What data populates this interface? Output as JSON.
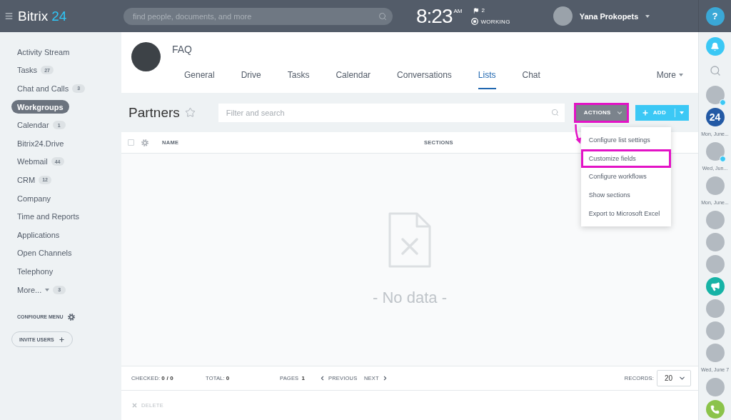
{
  "top_bar": {
    "logo": {
      "text": "Bitrix",
      "number": "24"
    },
    "search": {
      "placeholder": "find people, documents, and more"
    },
    "clock": {
      "time": "8:23",
      "period": "AM"
    },
    "flags": "2",
    "work_status": "WORKING",
    "user": {
      "name": "Yana Prokopets"
    },
    "help": "?"
  },
  "sidebar": {
    "items": [
      {
        "label": "Activity Stream",
        "selected": false,
        "dropdown": false
      },
      {
        "label": "Tasks",
        "count": "27",
        "selected": false,
        "dropdown": false
      },
      {
        "label": "Chat and Calls",
        "count": "3",
        "selected": false,
        "dropdown": false
      },
      {
        "label": "Workgroups",
        "selected": true,
        "dropdown": false
      },
      {
        "label": "Calendar",
        "count": "1",
        "selected": false,
        "dropdown": false
      },
      {
        "label": "Bitrix24.Drive",
        "selected": false,
        "dropdown": false
      },
      {
        "label": "Webmail",
        "count": "44",
        "selected": false,
        "dropdown": false
      },
      {
        "label": "CRM",
        "count": "12",
        "selected": false,
        "dropdown": false
      },
      {
        "label": "Company",
        "selected": false,
        "dropdown": false
      },
      {
        "label": "Time and Reports",
        "selected": false,
        "dropdown": false
      },
      {
        "label": "Applications",
        "selected": false,
        "dropdown": false
      },
      {
        "label": "Open Channels",
        "selected": false,
        "dropdown": false
      },
      {
        "label": "Telephony",
        "selected": false,
        "dropdown": false
      },
      {
        "label": "More...",
        "count": "3",
        "selected": false,
        "dropdown": true
      }
    ],
    "configure": "CONFIGURE MENU",
    "invite": "INVITE USERS"
  },
  "group": {
    "title": "FAQ",
    "tabs": [
      {
        "label": "General",
        "selected": false
      },
      {
        "label": "Drive",
        "selected": false
      },
      {
        "label": "Tasks",
        "selected": false
      },
      {
        "label": "Calendar",
        "selected": false
      },
      {
        "label": "Conversations",
        "selected": false
      },
      {
        "label": "Lists",
        "selected": true
      },
      {
        "label": "Chat",
        "selected": false
      }
    ],
    "more": "More"
  },
  "list": {
    "title": "Partners",
    "filter": {
      "placeholder": "Filter and search"
    },
    "actions": {
      "label": "ACTIONS",
      "highlighted": true
    },
    "add": {
      "label": "ADD"
    },
    "menu": {
      "pointer_arrow": true,
      "items": [
        {
          "label": "Configure list settings",
          "highlighted": false
        },
        {
          "label": "Customize fields",
          "highlighted": true
        },
        {
          "label": "Configure workflows",
          "highlighted": false
        },
        {
          "label": "Show sections",
          "highlighted": false
        },
        {
          "label": "Export to Microsoft Excel",
          "highlighted": false
        }
      ]
    }
  },
  "table": {
    "select_all": {
      "checked": false
    },
    "columns": [
      "NAME",
      "SECTIONS"
    ],
    "empty_text": "- No data -"
  },
  "footer": {
    "checked_label": "CHECKED:",
    "checked": "0 / 0",
    "total_label": "TOTAL:",
    "total": "0",
    "pages_label": "PAGES",
    "page": "1",
    "previous": "PREVIOUS",
    "next": "NEXT",
    "records_label": "RECORDS:",
    "records": "20"
  },
  "delete": {
    "label": "DELETE",
    "disabled": true
  },
  "right_panel": {
    "items": [
      {
        "kind": "bell"
      },
      {
        "kind": "search"
      },
      {
        "kind": "avatar",
        "badge": true
      },
      {
        "kind": "logo",
        "text": "24",
        "caption": "Mon, June..."
      },
      {
        "kind": "avatar",
        "badge": true,
        "caption": "Wed, Jun..."
      },
      {
        "kind": "avatar",
        "badge": false,
        "caption": "Mon, June..."
      },
      {
        "kind": "avatar",
        "badge": false
      },
      {
        "kind": "avatar",
        "badge": false
      },
      {
        "kind": "avatar",
        "badge": false
      },
      {
        "kind": "megaphone"
      },
      {
        "kind": "avatar",
        "badge": false
      },
      {
        "kind": "avatar",
        "badge": false
      },
      {
        "kind": "avatar",
        "badge": false,
        "caption": "Wed, June 7"
      },
      {
        "kind": "avatar",
        "badge": false
      },
      {
        "kind": "phone"
      }
    ]
  }
}
